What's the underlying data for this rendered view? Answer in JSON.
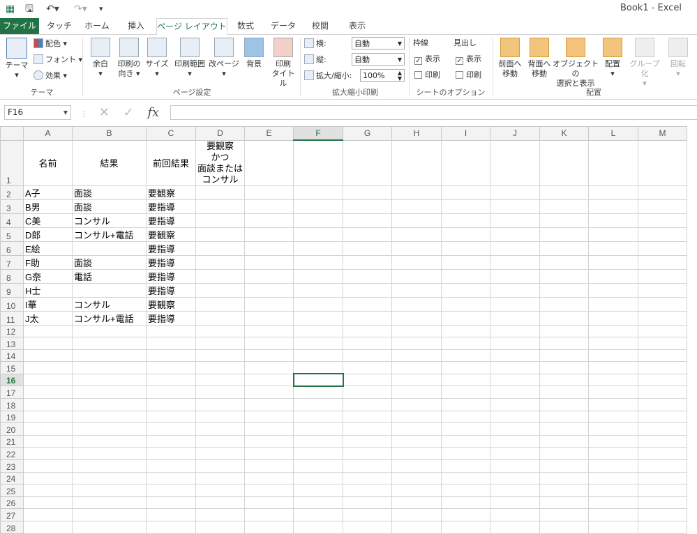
{
  "window": {
    "title": "Book1 - Excel"
  },
  "tabs": [
    "ファイル",
    "タッチ",
    "ホーム",
    "挿入",
    "ページ レイアウト",
    "数式",
    "データ",
    "校閲",
    "表示"
  ],
  "ribbon": {
    "theme": {
      "theme_label": "テーマ",
      "colors_label": "配色",
      "fonts_label": "フォント",
      "effects_label": "効果",
      "group_label": "テーマ"
    },
    "page_setup": {
      "margins": "余白",
      "orientation": "印刷の\n向き",
      "size": "サイズ",
      "print_area": "印刷範囲",
      "breaks": "改ページ",
      "background": "背景",
      "print_titles": "印刷\nタイトル",
      "group_label": "ページ設定"
    },
    "scale": {
      "width_label": "横:",
      "width_value": "自動",
      "height_label": "縦:",
      "height_value": "自動",
      "scale_label": "拡大/縮小:",
      "scale_value": "100%",
      "group_label": "拡大縮小印刷"
    },
    "sheet_options": {
      "gridlines": "枠線",
      "headings": "見出し",
      "view": "表示",
      "print": "印刷",
      "group_label": "シートのオプション"
    },
    "arrange": {
      "bring_forward": "前面へ\n移動",
      "send_backward": "背面へ\n移動",
      "selection_pane": "オブジェクトの\n選択と表示",
      "align": "配置",
      "group": "グループ化",
      "rotate": "回転",
      "group_label": "配置"
    }
  },
  "formula_bar": {
    "name_box": "F16",
    "fx": "fx",
    "formula": ""
  },
  "columns": [
    "A",
    "B",
    "C",
    "D",
    "E",
    "F",
    "G",
    "H",
    "I",
    "J",
    "K",
    "L",
    "M"
  ],
  "active_cell": "F16",
  "header_row": {
    "a": "名前",
    "b": "結果",
    "c": "前回結果",
    "d": "要観察\nかつ\n面談または\nコンサル"
  },
  "rows": [
    [
      "A子",
      "面談",
      "要観察"
    ],
    [
      "B男",
      "面談",
      "要指導"
    ],
    [
      "C美",
      "コンサル",
      "要指導"
    ],
    [
      "D郎",
      "コンサル+電話",
      "要観察"
    ],
    [
      "E絵",
      "",
      "要指導"
    ],
    [
      "F助",
      "面談",
      "要指導"
    ],
    [
      "G奈",
      "電話",
      "要指導"
    ],
    [
      "H士",
      "",
      "要指導"
    ],
    [
      "I華",
      "コンサル",
      "要観察"
    ],
    [
      "J太",
      "コンサル+電話",
      "要指導"
    ]
  ],
  "row_numbers": [
    "1",
    "2",
    "3",
    "4",
    "5",
    "6",
    "7",
    "8",
    "9",
    "10",
    "11",
    "12",
    "13",
    "14",
    "15",
    "16",
    "17",
    "18",
    "19",
    "20",
    "21",
    "22",
    "23",
    "24",
    "25",
    "26",
    "27",
    "28"
  ]
}
